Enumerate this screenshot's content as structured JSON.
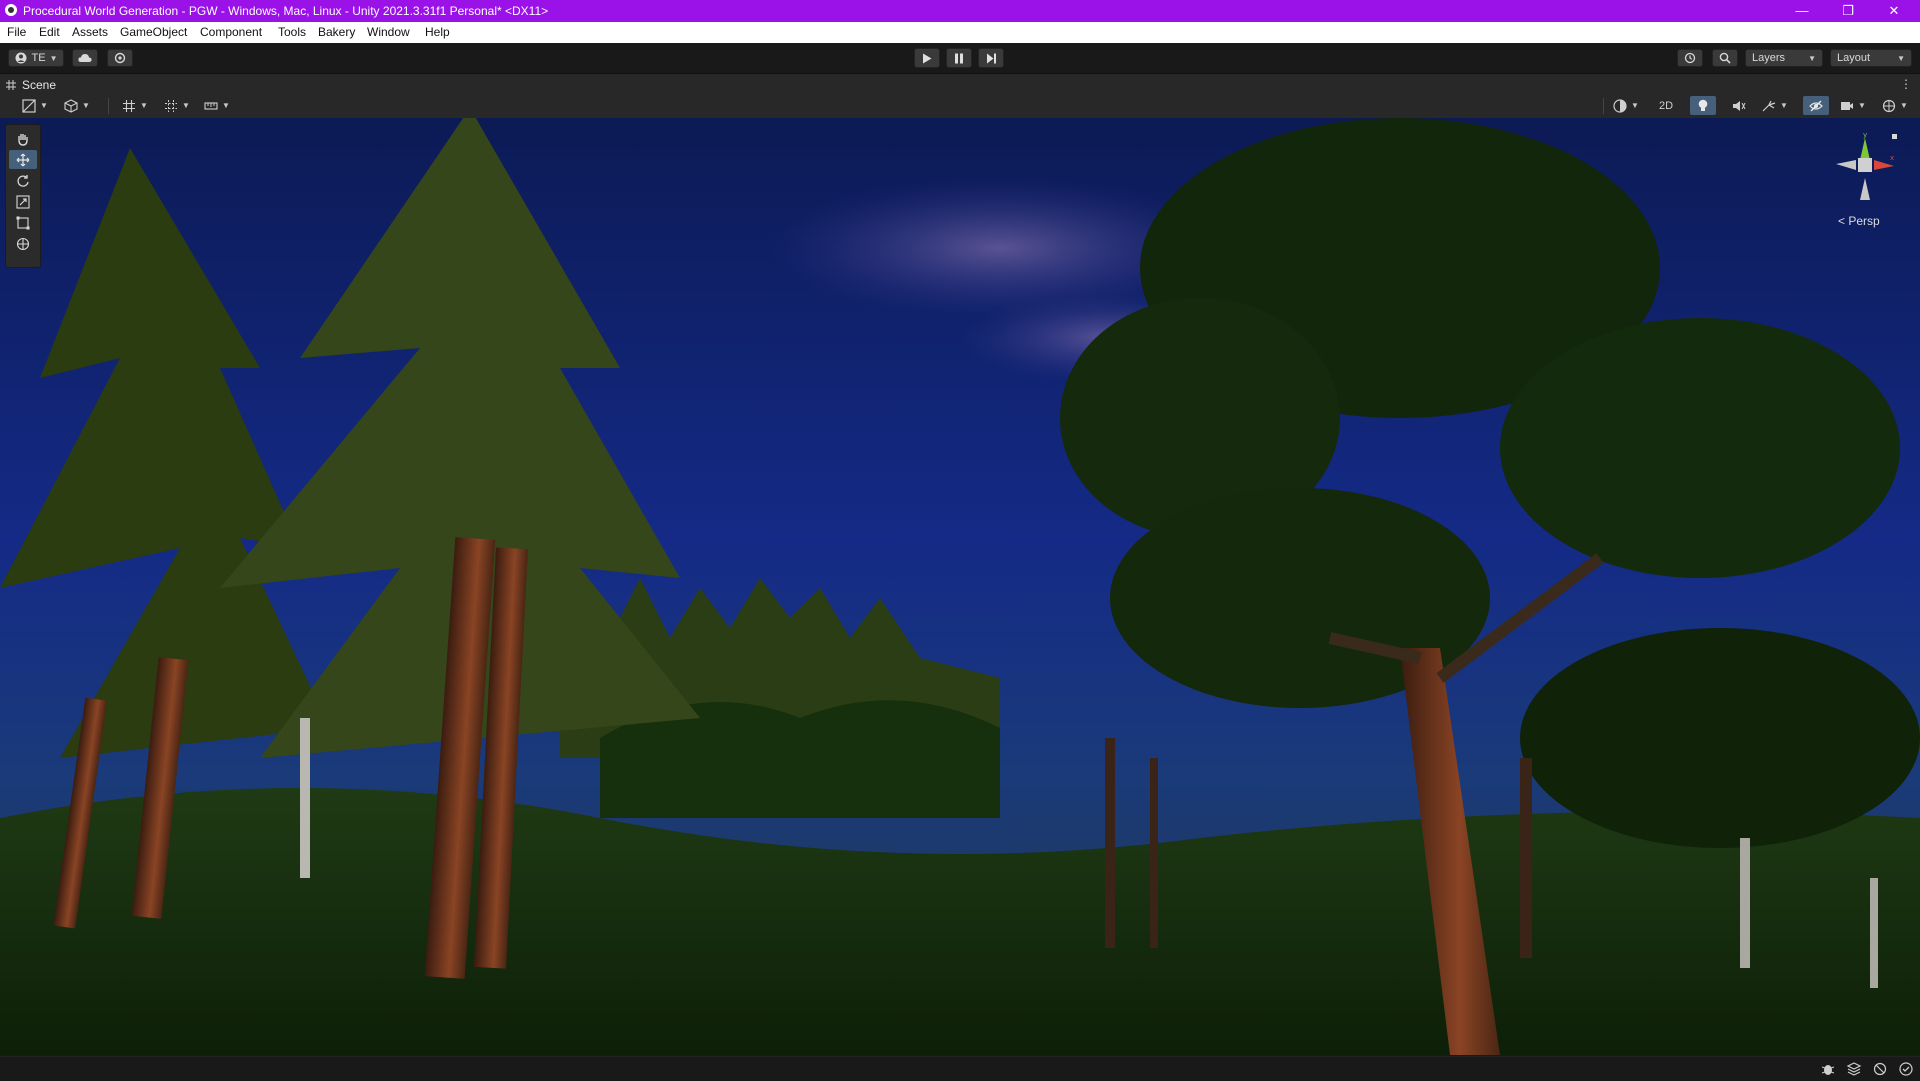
{
  "window": {
    "title": "Procedural World Generation - PGW - Windows, Mac, Linux - Unity 2021.3.31f1 Personal* <DX11>",
    "controls": [
      "—",
      "❐",
      "✕"
    ]
  },
  "menu": [
    "File",
    "Edit",
    "Assets",
    "GameObject",
    "Component",
    "Tools",
    "Bakery",
    "Window",
    "Help"
  ],
  "toolbar": {
    "account_label": "TE",
    "layers_label": "Layers",
    "layout_label": "Layout"
  },
  "scene": {
    "tab_label": "Scene",
    "mode_2d_label": "2D",
    "persp_label": "< Persp"
  },
  "colors": {
    "titlebar": "#9a12e8",
    "editor_bg": "#191919",
    "panel": "#282828",
    "active_tool": "#46607c"
  }
}
